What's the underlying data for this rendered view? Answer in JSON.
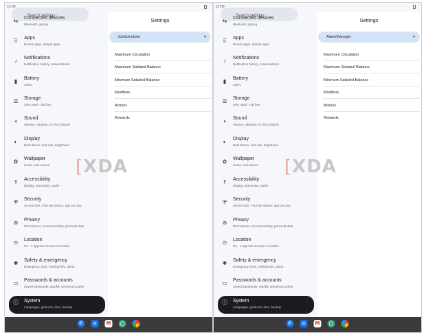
{
  "screens": [
    {
      "time": "12:00",
      "search_placeholder": "Search settings",
      "pane_title": "Settings",
      "dropdown_value": "JobScheduler",
      "options": [
        "Maximum Circulation",
        "Maximum Satiated Balance",
        "Minimum Satiated Balance",
        "Modifiers",
        "Actions",
        "Rewards"
      ]
    },
    {
      "time": "12:00",
      "search_placeholder": "Search settings",
      "pane_title": "Settings",
      "dropdown_value": "AlarmManager",
      "options": [
        "Maximum Circulation",
        "Maximum Satiated Balance",
        "Minimum Satiated Balance",
        "Modifiers",
        "Actions",
        "Rewards"
      ]
    }
  ],
  "settings_items": [
    {
      "title": "Connected devices",
      "subtitle": "Bluetooth, pairing",
      "icon": "connected-devices-icon"
    },
    {
      "title": "Apps",
      "subtitle": "Recent apps, default apps",
      "icon": "apps-icon"
    },
    {
      "title": "Notifications",
      "subtitle": "Notification history, conversations",
      "icon": "bell-icon"
    },
    {
      "title": "Battery",
      "subtitle": "100%",
      "icon": "battery-icon"
    },
    {
      "title": "Storage",
      "subtitle": "29% used - GB free",
      "icon": "storage-icon"
    },
    {
      "title": "Sound",
      "subtitle": "Volume, vibration, Do Not Disturb",
      "icon": "sound-icon"
    },
    {
      "title": "Display",
      "subtitle": "Dark theme, font size, brightness",
      "icon": "display-icon"
    },
    {
      "title": "Wallpaper",
      "subtitle": "Home, lock screen",
      "icon": "wallpaper-icon"
    },
    {
      "title": "Accessibility",
      "subtitle": "Display, interaction, audio",
      "icon": "accessibility-icon"
    },
    {
      "title": "Security",
      "subtitle": "Screen lock, Find My Device, app security",
      "icon": "shield-icon"
    },
    {
      "title": "Privacy",
      "subtitle": "Permissions, account activity, personal data",
      "icon": "privacy-icon"
    },
    {
      "title": "Location",
      "subtitle": "On - 1 app has access to location",
      "icon": "location-icon"
    },
    {
      "title": "Safety & emergency",
      "subtitle": "Emergency SOS, medical info, alerts",
      "icon": "emergency-icon"
    },
    {
      "title": "Passwords & accounts",
      "subtitle": "Saved passwords, autofill, synced accounts",
      "icon": "passwords-icon"
    },
    {
      "title": "System",
      "subtitle": "Languages, gestures, time, backup",
      "icon": "info-icon"
    }
  ],
  "selected_item": "System",
  "dock_apps": [
    "phone-icon",
    "messages-icon",
    "gmail-icon",
    "chrome-icon",
    "photos-icon"
  ],
  "watermark": "XDA",
  "colors": {
    "selected_bg": "#1b1c22",
    "dropdown_bg": "#d5e3f7",
    "taskbar_bg": "#3a3a3d"
  }
}
